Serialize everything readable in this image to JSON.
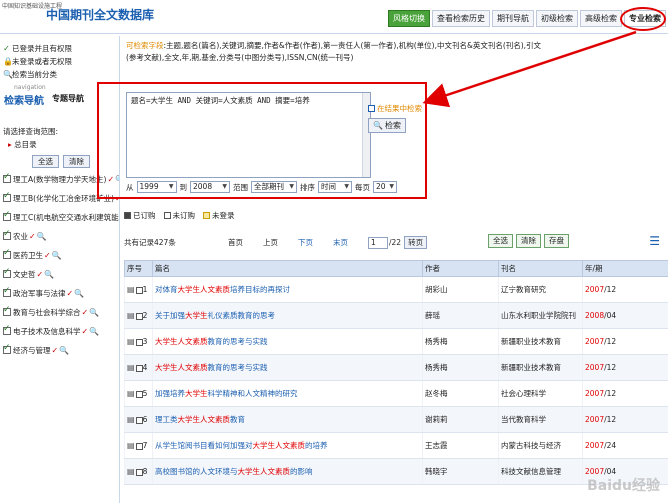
{
  "header": {
    "site_small": "中国知识基础设施工程",
    "title": "中国期刊全文数据库",
    "nav": [
      {
        "label": "风格切换",
        "style": "green"
      },
      {
        "label": "查看检索历史",
        "style": "normal"
      },
      {
        "label": "期刊导航",
        "style": "normal"
      },
      {
        "label": "初级检索",
        "style": "normal"
      },
      {
        "label": "高级检索",
        "style": "normal"
      },
      {
        "label": "专业检索",
        "style": "active"
      }
    ]
  },
  "sidebar": {
    "top_items": [
      {
        "label": "已登录并且有权限",
        "bullet": "✓"
      },
      {
        "label": "未登录或者无权限",
        "bullet": "🔒"
      },
      {
        "label": "检索当前分类",
        "bullet": "🔍"
      }
    ],
    "nav_small": "navigation",
    "nav_big": "检索导航",
    "nav_mode": "专题导航",
    "range_label": "请选择查询范围:",
    "root": "总目录",
    "select_all": "全选",
    "clear": "清除",
    "categories": [
      "理工A(数学物理力学天地生)",
      "理工B(化学化工冶金环境矿业)",
      "理工C(机电航空交通水利建筑能源)",
      "农业",
      "医药卫生",
      "文史哲",
      "政治军事与法律",
      "教育与社会科学综合",
      "电子技术及信息科学",
      "经济与管理"
    ]
  },
  "search": {
    "fields_label": "可检索字段",
    "fields_text": ":主题,题名(篇名),关键词,摘要,作者&作者(作者),第一责任人(第一作者),机构(单位),中文刊名&英文刊名(刊名),引文(参考文献),全文,年,期,基金,分类号(中图分类号),ISSN,CN(统一刊号)",
    "query": "题名=大学生 AND 关键词=人文素质 AND 摘要=培养",
    "in_results": "在结果中检索",
    "search_btn": "检索",
    "from_label": "从",
    "from_year": "1999",
    "to_label": "到",
    "to_year": "2008",
    "range_label": "范围",
    "range_value": "全部期刊",
    "sort_label": "排序",
    "sort_value": "时间",
    "per_page_label": "每页",
    "per_page_value": "20"
  },
  "legend": {
    "subscribed": "已订购",
    "unsubscribed": "未订购",
    "not_logged": "未登录"
  },
  "results": {
    "count_text": "共有记录427条",
    "first": "首页",
    "prev": "上页",
    "next": "下页",
    "last": "末页",
    "page": "1",
    "page_total": "/22",
    "go": "转页",
    "select_all": "全选",
    "clear": "清除",
    "save": "存盘",
    "columns": [
      "序号",
      "篇名",
      "作者",
      "刊名",
      "年/期"
    ],
    "rows": [
      {
        "no": "1",
        "pre": "对体育",
        "hl": "大学生人文素质",
        "post": "培养目标的再探讨",
        "author": "胡彩山",
        "journal": "辽宁教育研究",
        "year": "2007",
        "issue": "/12"
      },
      {
        "no": "2",
        "pre": "关于加强",
        "hl": "大学生",
        "post": "礼仪素质教育的思考",
        "author": "薛瑶",
        "journal": "山东水利职业学院院刊",
        "year": "2008",
        "issue": "/04"
      },
      {
        "no": "3",
        "pre": "",
        "hl": "大学生人文素质",
        "post": "教育的思考与实践",
        "author": "杨秀梅",
        "journal": "新疆职业技术教育",
        "year": "2007",
        "issue": "/12"
      },
      {
        "no": "4",
        "pre": "",
        "hl": "大学生人文素质",
        "post": "教育的思考与实践",
        "author": "杨秀梅",
        "journal": "新疆职业技术教育",
        "year": "2007",
        "issue": "/12"
      },
      {
        "no": "5",
        "pre": "加强培养",
        "hl": "大学生",
        "post": "科学精神和人文精神的研究",
        "author": "赵冬梅",
        "journal": "社会心理科学",
        "year": "2007",
        "issue": "/12"
      },
      {
        "no": "6",
        "pre": "理工类",
        "hl": "大学生人文素质",
        "post": "教育",
        "author": "谢莉莉",
        "journal": "当代教育科学",
        "year": "2007",
        "issue": "/12"
      },
      {
        "no": "7",
        "pre": "从学生馆阅书目看如何加强对",
        "hl": "大学生人文素质",
        "post": "的培养",
        "author": "王志霞",
        "journal": "内蒙古科技与经济",
        "year": "2007",
        "issue": "/24"
      },
      {
        "no": "8",
        "pre": "高校图书馆的人文环境与",
        "hl": "大学生人文素质",
        "post": "的影响",
        "author": "韩晓宇",
        "journal": "科技文献信息管理",
        "year": "2007",
        "issue": "/04"
      }
    ]
  },
  "colors": {
    "accent": "#1b5fb0",
    "highlight": "#e00000",
    "header_green": "#4aa33a",
    "table_header": "#d7e3f3"
  },
  "watermark": "Baidu经验"
}
